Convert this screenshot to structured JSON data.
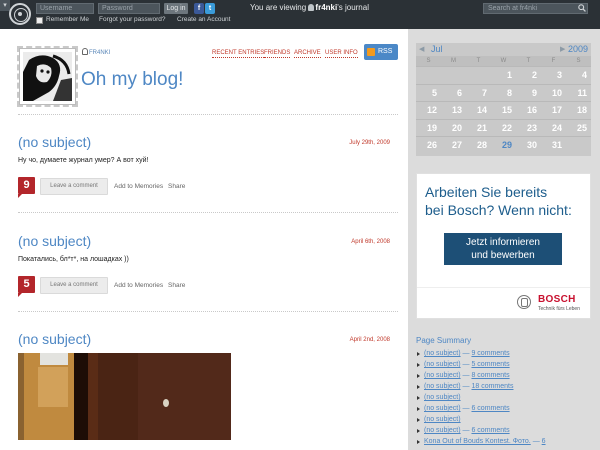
{
  "topbar": {
    "username_placeholder": "Username",
    "password_placeholder": "Password",
    "login_label": "Log in",
    "fb_glyph": "f",
    "tw_glyph": "t",
    "more_glyph": "▾",
    "remember_label": "Remember Me",
    "forgot_label": "Forgot your password?",
    "create_label": "Create an Account",
    "viewing_prefix": "You are viewing",
    "viewing_user": "fr4nki",
    "viewing_suffix": "'s journal",
    "search_placeholder": "Search at fr4nki"
  },
  "header": {
    "owner": "FR4NKI",
    "title": "Oh my blog!",
    "nav": [
      "RECENT ENTRIES",
      "FRIENDS",
      "ARCHIVE",
      "USER INFO"
    ],
    "rss_label": "RSS"
  },
  "posts": [
    {
      "title": "(no subject)",
      "date": "July 29th, 2009",
      "text": "Ну чо, думаете журнал умер? А вот хуй!",
      "comments": "9",
      "leave": "Leave a comment",
      "memories": "Add to Memories",
      "share": "Share"
    },
    {
      "title": "(no subject)",
      "date": "April 6th, 2008",
      "text": "Покатались, бл*т*, на лошадках ))",
      "comments": "5",
      "leave": "Leave a comment",
      "memories": "Add to Memories",
      "share": "Share"
    },
    {
      "title": "(no subject)",
      "date": "April 2nd, 2008"
    }
  ],
  "calendar": {
    "prev_glyph": "◀",
    "next_glyph": "▶",
    "month": "Jul",
    "year": "2009",
    "weekdays": [
      "S",
      "M",
      "T",
      "W",
      "T",
      "F",
      "S"
    ],
    "rows": [
      [
        "",
        "",
        "",
        "1",
        "2",
        "3",
        "4"
      ],
      [
        "5",
        "6",
        "7",
        "8",
        "9",
        "10",
        "11"
      ],
      [
        "12",
        "13",
        "14",
        "15",
        "16",
        "17",
        "18"
      ],
      [
        "19",
        "20",
        "21",
        "22",
        "23",
        "24",
        "25"
      ],
      [
        "26",
        "27",
        "28",
        "29",
        "30",
        "31",
        ""
      ]
    ],
    "highlight": "29",
    "colors": {
      "accent": "#4e87c4",
      "cell": "#c9c9c9"
    }
  },
  "ad": {
    "line1": "Arbeiten Sie bereits",
    "line2": "bei Bosch? Wenn nicht:",
    "btn_line1": "Jetzt informieren",
    "btn_line2": "und bewerben",
    "brand": "BOSCH",
    "slogan": "Technik fürs Leben"
  },
  "summary": {
    "title": "Page Summary",
    "items": [
      {
        "subject": "(no subject)",
        "comments": "9 comments"
      },
      {
        "subject": "(no subject)",
        "comments": "5 comments"
      },
      {
        "subject": "(no subject)",
        "comments": "8 comments"
      },
      {
        "subject": "(no subject)",
        "comments": "18 comments"
      },
      {
        "subject": "(no subject)",
        "comments": ""
      },
      {
        "subject": "(no subject)",
        "comments": "6 comments"
      },
      {
        "subject": "(no subject)",
        "comments": ""
      },
      {
        "subject": "(no subject)",
        "comments": "6 comments"
      },
      {
        "subject": "Kona Out of Bouds Kontest. Фото.",
        "comments": "6"
      }
    ]
  },
  "colors": {
    "accent": "#4e87c4",
    "badge": "#b3262b",
    "link_red": "#c0392b",
    "topbar": "#2b3136"
  }
}
